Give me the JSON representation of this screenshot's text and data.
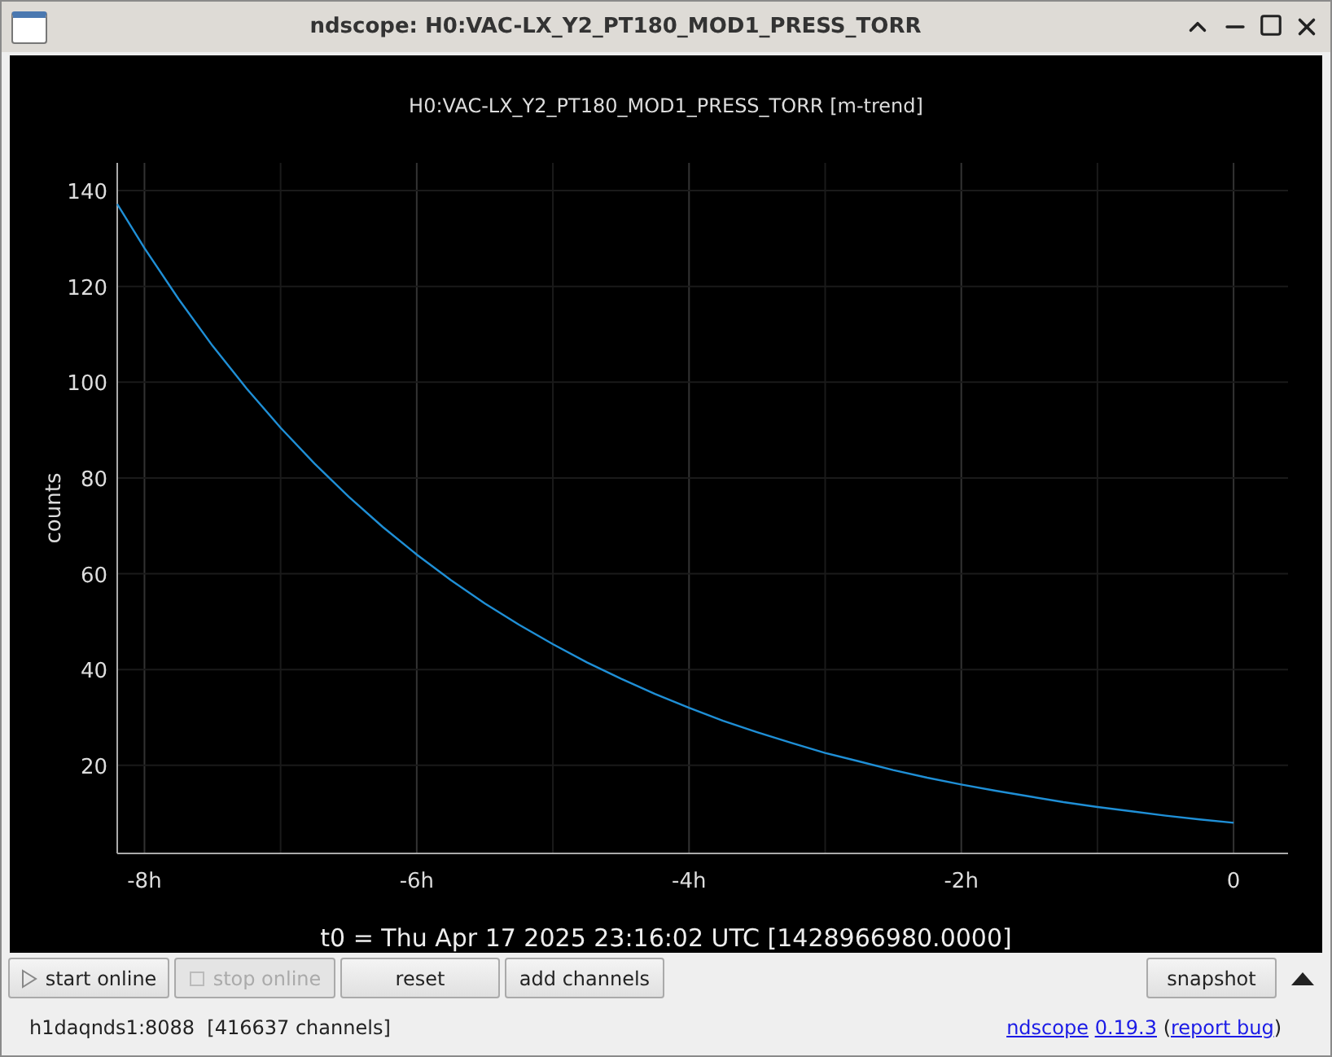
{
  "window": {
    "title": "ndscope: H0:VAC-LX_Y2_PT180_MOD1_PRESS_TORR"
  },
  "plot": {
    "title": "H0:VAC-LX_Y2_PT180_MOD1_PRESS_TORR [m-trend]",
    "t0": "t0 = Thu Apr 17 2025 23:16:02 UTC [1428966980.0000]",
    "chart_data": {
      "type": "line",
      "ylabel": "counts",
      "grid": true,
      "xlim": [
        -8.2,
        0.4
      ],
      "ylim": [
        1.6,
        145.8
      ],
      "xticks": [
        {
          "value": -8,
          "label": "-8h"
        },
        {
          "value": -6,
          "label": "-6h"
        },
        {
          "value": -4,
          "label": "-4h"
        },
        {
          "value": -2,
          "label": "-2h"
        },
        {
          "value": 0,
          "label": "0"
        }
      ],
      "yticks": [
        20,
        40,
        60,
        80,
        100,
        120,
        140
      ],
      "x": [
        -8.2,
        -8,
        -7.75,
        -7.5,
        -7.25,
        -7,
        -6.75,
        -6.5,
        -6.25,
        -6,
        -5.75,
        -5.5,
        -5.25,
        -5,
        -4.75,
        -4.5,
        -4.25,
        -4,
        -3.75,
        -3.5,
        -3.25,
        -3,
        -2.75,
        -2.5,
        -2.25,
        -2,
        -1.75,
        -1.5,
        -1.25,
        -1,
        -0.75,
        -0.5,
        -0.25,
        0
      ],
      "series": [
        {
          "color": "#1f8fd6",
          "values": [
            137.2,
            128,
            117.4,
            107.6,
            98.7,
            90.5,
            83,
            76.1,
            69.8,
            64,
            58.7,
            53.8,
            49.4,
            45.3,
            41.5,
            38.1,
            34.9,
            32,
            29.3,
            26.9,
            24.7,
            22.6,
            20.8,
            19,
            17.4,
            16,
            14.7,
            13.5,
            12.3,
            11.3,
            10.4,
            9.5,
            8.7,
            8
          ]
        }
      ]
    }
  },
  "buttons": [
    {
      "label": "start online",
      "kind": "play",
      "disabled": false
    },
    {
      "label": "stop online",
      "kind": "stop",
      "disabled": true
    },
    {
      "label": "reset",
      "kind": "plain",
      "disabled": false
    },
    {
      "label": "add channels",
      "kind": "plain",
      "disabled": false
    }
  ],
  "snapshot": {
    "label": "snapshot"
  },
  "status": {
    "server": "h1daqnds1:8088  [416637 channels]",
    "app_link": "ndscope",
    "version_link": "0.19.3",
    "bug_open": "(",
    "bug_link": "report bug",
    "bug_close": ")"
  }
}
